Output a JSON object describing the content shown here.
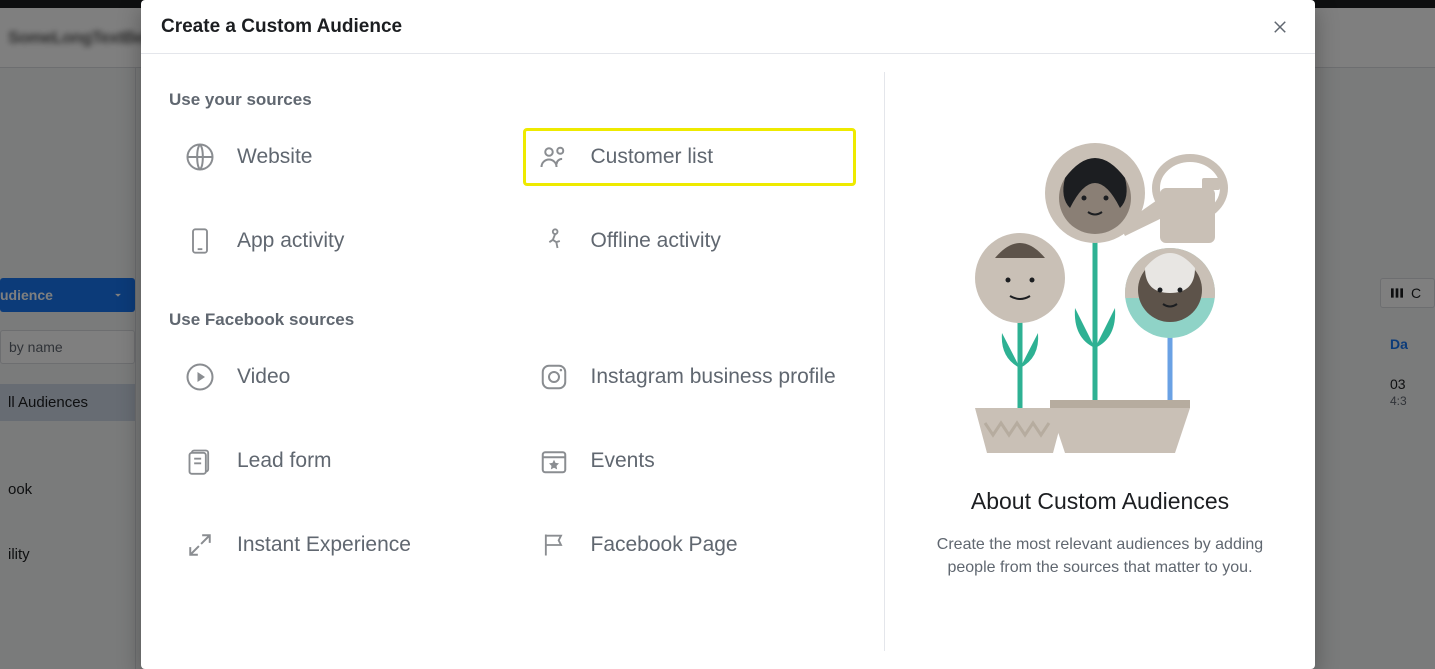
{
  "background": {
    "header_blur_text": "SomeLongTextBehindModal",
    "audience_button": "udience",
    "search_placeholder": "by name",
    "all_audiences": "ll Audiences",
    "link1": "ook",
    "link2": "ility",
    "columns_tail": "C",
    "date_header": "Da",
    "date_val": "03",
    "date_sub": "4:3"
  },
  "modal": {
    "title": "Create a Custom Audience",
    "your_sources_heading": "Use your sources",
    "fb_sources_heading": "Use Facebook sources",
    "options": {
      "website": "Website",
      "customer_list": "Customer list",
      "app_activity": "App activity",
      "offline_activity": "Offline activity",
      "video": "Video",
      "instagram": "Instagram business profile",
      "lead_form": "Lead form",
      "events": "Events",
      "instant_experience": "Instant Experience",
      "facebook_page": "Facebook Page"
    },
    "about_title": "About Custom Audiences",
    "about_desc": "Create the most relevant audiences by adding people from the sources that matter to you."
  }
}
